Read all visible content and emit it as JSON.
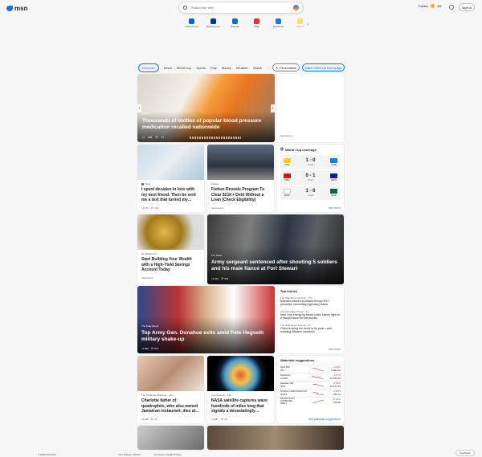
{
  "header": {
    "logo_text": "msn",
    "search_placeholder": "Search the web",
    "location": "Fairfax",
    "temperature": "48°",
    "signin_label": "Sign in"
  },
  "quick_links": [
    {
      "label": "Outlook.com",
      "color": "#0a64c8"
    },
    {
      "label": "Booking.com",
      "color": "#003580"
    },
    {
      "label": "Walmart",
      "color": "#0071ce"
    },
    {
      "label": "eBay",
      "color": "#e53238"
    },
    {
      "label": "Facebook",
      "color": "#1877f2"
    },
    {
      "label": "Games",
      "color": "#f5c000"
    }
  ],
  "nav": {
    "tabs": [
      "Discover",
      "News",
      "World Cup",
      "Sports",
      "Play",
      "Money",
      "Weather",
      "Watch"
    ],
    "more": "···",
    "personalize_label": "Personalize",
    "homepage_label": "Make MSN my homepage"
  },
  "hero": {
    "source": "FOX8",
    "title": "Thousands of bottles of popular blood pressure medication recalled nationwide",
    "likes": "188",
    "comments": "57"
  },
  "sponsored_label": "Sponsored",
  "cards": {
    "c1": {
      "source": "Sodi",
      "title": "I spent decades in love with my best friend. Then he sent me a text that turned my…",
      "likes": "570",
      "comments": "116"
    },
    "c2": {
      "source": "Forbes",
      "title": "Forbes Reveals Program To Clear $21K+ Debt Without a Loan (Check Eligibility)",
      "label": "Sponsored"
    },
    "c3": {
      "source": "NerdWallet Inc.",
      "title": "Start Building Your Wealth with a High-Yield Savings Account Today",
      "label": "Sponsored"
    },
    "c4": {
      "source": "Fox News",
      "title": "Army sergeant sentenced after shooting 5 soldiers and his male fiancé at Fort Stewart",
      "likes": "340",
      "comments": "354"
    },
    "c5": {
      "source": "The Daily Beast",
      "title": "Top Army Gen. Donahue exits amid Pete Hegseth military shake-up",
      "likes": "863",
      "comments": "570"
    },
    "c6": {
      "source": "The Charlotte Observer · 41m",
      "title": "Charlotte father of quadruplets, who also owned Jamaican restaurant, dies at…",
      "likes": "185",
      "comments": "47"
    },
    "c7": {
      "source": "Live Science · 10h",
      "title": "NASA satellite captures wave hundreds of miles long that signals a devastatingly…",
      "likes": "387",
      "comments": "35"
    }
  },
  "world_cup": {
    "title": "World Cup coverage",
    "matches": [
      {
        "home": "COL",
        "away": "COD",
        "score": "1 - 0",
        "status": "Final",
        "home_color": "#fcd116",
        "away_color": "#007fff"
      },
      {
        "home": "PAN",
        "away": "CRO",
        "score": "0 - 1",
        "status": "Final",
        "home_color": "#da121a",
        "away_color": "#171796"
      },
      {
        "home": "ENG",
        "away": "GHA",
        "score": "1 - 0",
        "status": "Final",
        "home_color": "#ffffff",
        "away_color": "#006b3f"
      }
    ],
    "see_more": "See more"
  },
  "top_stories": {
    "title": "Top stories",
    "items": [
      {
        "source": "The Wall Street Journal · 47m",
        "headline": "Maintain-backed socialists recoup NYC primaries, cementing legendary status"
      },
      {
        "source": "The Associated Press · 4h",
        "headline": "New York energy by board critics shines light on a fraught issue for Democrats"
      },
      {
        "source": "The Wall Street Journal · 2h",
        "headline": "China is luring the world to Its yuan—and hobbling Western sanctions"
      }
    ],
    "see_more": "See more"
  },
  "watchlist": {
    "title": "Watchlist suggestions",
    "items": [
      {
        "name": "S&P 500",
        "sub": "INX",
        "change": "-1.45%",
        "price": "6,890.00"
      },
      {
        "name": "NASDAQ",
        "sub": "COMP",
        "change": "-1.27%",
        "price": "21,456.45"
      },
      {
        "name": "Nasdaq 100",
        "sub": "NDX",
        "change": "-0.32%",
        "price": "24,417.44"
      },
      {
        "name": "NVIDIA CORPORATION",
        "sub": "NVDA",
        "change": "-4.00%",
        "price": "183.14"
      },
      {
        "name": "MICROSOFT CORPORA…",
        "sub": "MSFT",
        "change": "+0.52%",
        "price": "478.98"
      }
    ],
    "see_more": "See watchlist suggestions"
  },
  "footer": {
    "copyright": "© 2026 Microsoft",
    "privacy": "Your Privacy Choices",
    "consumer": "Consumer Health Privacy",
    "feedback": "Feedback"
  }
}
